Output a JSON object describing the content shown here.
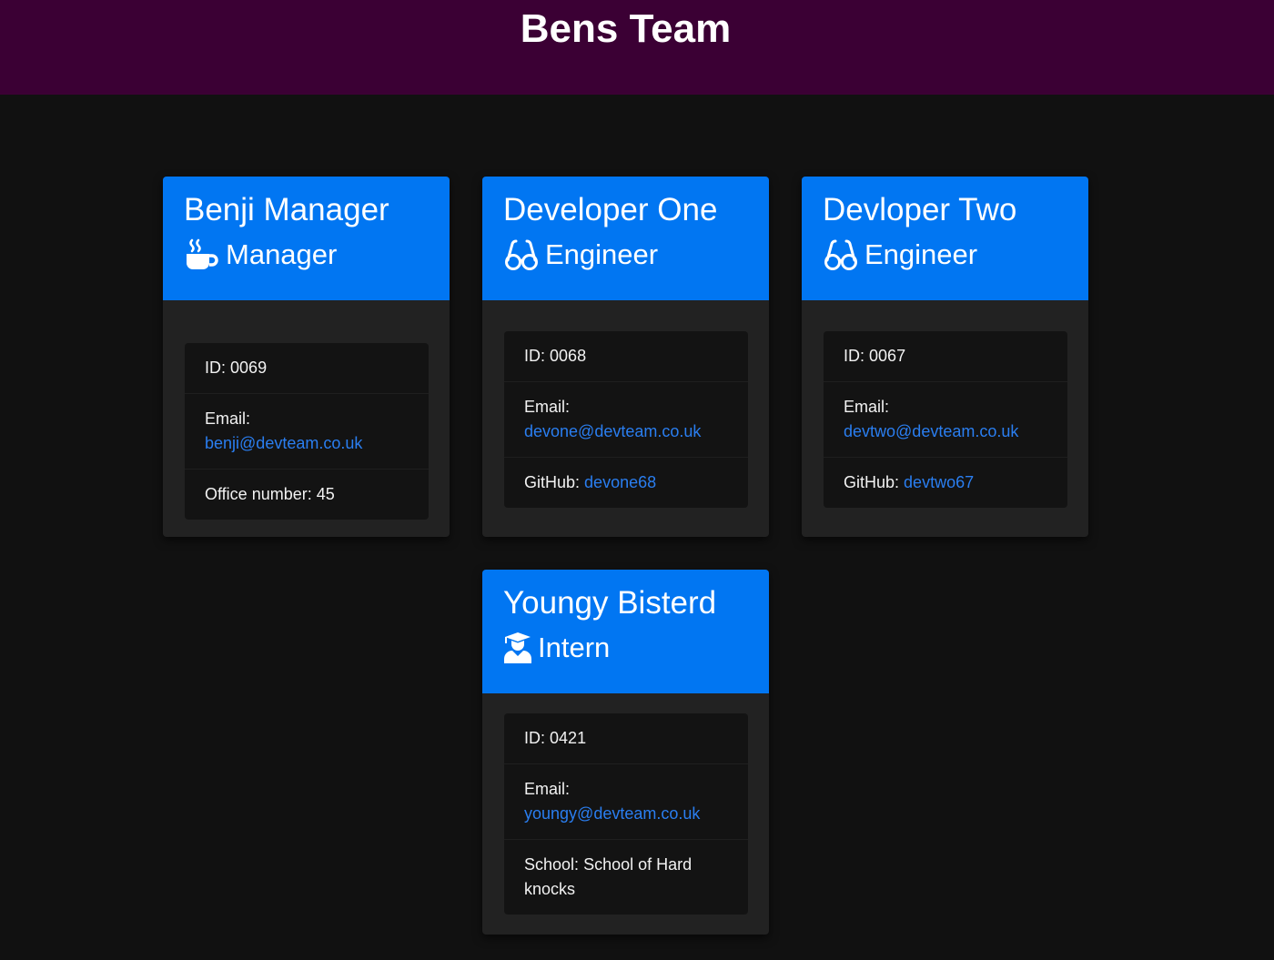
{
  "header": {
    "title": "Bens Team"
  },
  "cards": [
    {
      "name": "Benji Manager",
      "role": "Manager",
      "role_icon": "coffee-icon",
      "id_label": "ID:",
      "id": "0069",
      "email_label": "Email:",
      "email": "benji@devteam.co.uk",
      "extra_label": "Office number:",
      "extra_value": "45"
    },
    {
      "name": "Developer One",
      "role": "Engineer",
      "role_icon": "glasses-icon",
      "id_label": "ID:",
      "id": "0068",
      "email_label": "Email:",
      "email": "devone@devteam.co.uk",
      "extra_label": "GitHub:",
      "extra_value": "devone68"
    },
    {
      "name": "Devloper Two",
      "role": "Engineer",
      "role_icon": "glasses-icon",
      "id_label": "ID:",
      "id": "0067",
      "email_label": "Email:",
      "email": "devtwo@devteam.co.uk",
      "extra_label": "GitHub:",
      "extra_value": "devtwo67"
    },
    {
      "name": "Youngy Bisterd",
      "role": "Intern",
      "role_icon": "graduate-icon",
      "id_label": "ID:",
      "id": "0421",
      "email_label": "Email:",
      "email": "youngy@devteam.co.uk",
      "extra_label": "School:",
      "extra_value": "School of Hard knocks"
    }
  ],
  "colors": {
    "header_bg": "#3b0034",
    "page_bg": "#111111",
    "card_header": "#0176f2",
    "card_body": "#222222",
    "link": "#2a7ef0"
  }
}
